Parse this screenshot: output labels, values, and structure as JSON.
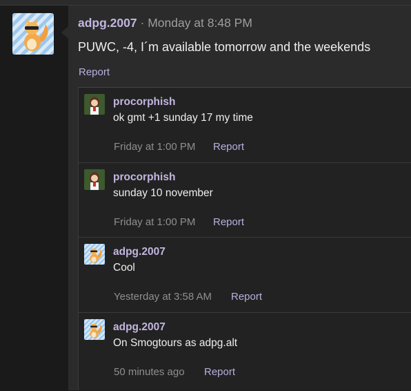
{
  "post": {
    "author": "adpg.2007",
    "separator": "·",
    "time": "Monday at 8:48 PM",
    "body": "PUWC, -4, I´m available tomorrow and the weekends",
    "report_label": "Report"
  },
  "replies": [
    {
      "author": "procorphish",
      "text": "ok gmt +1 sunday 17 my time",
      "time": "Friday at 1:00 PM",
      "report_label": "Report",
      "avatar": "trainer-avatar-icon"
    },
    {
      "author": "procorphish",
      "text": "sunday 10 november",
      "time": "Friday at 1:00 PM",
      "report_label": "Report",
      "avatar": "trainer-avatar-icon"
    },
    {
      "author": "adpg.2007",
      "text": "Cool",
      "time": "Yesterday at 3:58 AM",
      "report_label": "Report",
      "avatar": "orange-creature-avatar-icon"
    },
    {
      "author": "adpg.2007",
      "text": "On Smogtours as adpg.alt",
      "time": "50 minutes ago",
      "report_label": "Report",
      "avatar": "orange-creature-avatar-icon"
    }
  ],
  "colors": {
    "page_bg": "#1a1a1a",
    "panel_bg": "#2b2b2b",
    "reply_bg": "#222222",
    "username": "#c2b6e0",
    "link": "#b8b0e0",
    "meta": "#8f8f8f"
  }
}
